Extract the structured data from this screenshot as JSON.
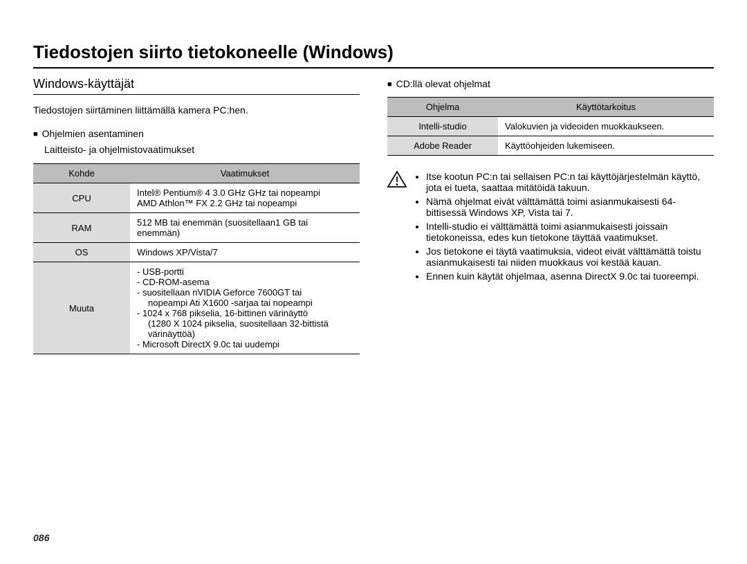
{
  "page_number": "086",
  "title": "Tiedostojen siirto tietokoneelle (Windows)",
  "left": {
    "subheading": "Windows-käyttäjät",
    "intro": "Tiedostojen siirtäminen liittämällä kamera PC:hen.",
    "install_heading": "Ohjelmien asentaminen",
    "req_heading": "Laitteisto- ja ohjelmistovaatimukset",
    "table": {
      "head_item": "Kohde",
      "head_req": "Vaatimukset",
      "rows": [
        {
          "item": "CPU",
          "req": "Intel® Pentium® 4 3.0 GHz GHz tai nopeampi\nAMD Athlon™ FX 2.2 GHz tai nopeampi"
        },
        {
          "item": "RAM",
          "req": "512 MB tai enemmän (suositellaan1 GB tai enemmän)"
        },
        {
          "item": "OS",
          "req": "Windows XP/Vista/7"
        },
        {
          "item": "Muuta",
          "req_lines": [
            "- USB-portti",
            "- CD-ROM-asema",
            "- suositellaan nVIDIA Geforce 7600GT tai",
            "  nopeampi Ati X1600 -sarjaa tai nopeampi",
            "- 1024 x 768 pikselia, 16-bittinen värinäyttö",
            "  (1280 X 1024 pikselia, suositellaan 32-bittistä",
            "  värinäyttöä)",
            "- Microsoft DirectX 9.0c tai uudempi"
          ]
        }
      ]
    }
  },
  "right": {
    "cd_heading": "CD:llä olevat ohjelmat",
    "table": {
      "head_prog": "Ohjelma",
      "head_purpose": "Käyttötarkoitus",
      "rows": [
        {
          "prog": "Intelli-studio",
          "purpose": "Valokuvien ja videoiden muokkaukseen."
        },
        {
          "prog": "Adobe Reader",
          "purpose": "Käyttöohjeiden lukemiseen."
        }
      ]
    },
    "warnings": [
      "Itse kootun PC:n tai sellaisen PC:n tai käyttöjärjestelmän käyttö, jota ei tueta, saattaa mitätöidä takuun.",
      "Nämä ohjelmat eivät välttämättä toimi asianmukaisesti 64-bittisessä Windows XP, Vista tai 7.",
      "Intelli-studio ei välttämättä toimi asianmukaisesti joissain tietokoneissa, edes kun tietokone täyttää vaatimukset.",
      "Jos tietokone ei täytä vaatimuksia, videot eivät välttämättä toistu asianmukaisesti tai niiden muokkaus voi kestää kauan.",
      "Ennen kuin käytät ohjelmaa, asenna DirectX 9.0c tai tuoreempi."
    ]
  }
}
